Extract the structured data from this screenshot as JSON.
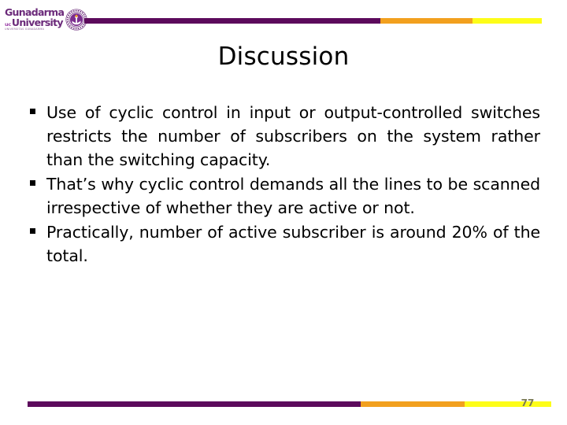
{
  "slide": {
    "title": "Discussion",
    "page_number": "77",
    "background_color": "#ffffff"
  },
  "logo": {
    "name": "Gunadarma University",
    "line1": "Gunadarma",
    "prefix": "uc",
    "line2": "University",
    "tagline": "UNIVERSITAS GUNADARMA",
    "emblem_icon": "university-crest-icon",
    "color": "#6b2a7a"
  },
  "decor": {
    "top_bar": [
      {
        "segment": "purple",
        "color": "#5c0a5c"
      },
      {
        "segment": "orange",
        "color": "#f2a01e"
      },
      {
        "segment": "yellow",
        "color": "#fdfd18"
      }
    ],
    "bottom_bar": [
      {
        "segment": "purple",
        "color": "#5c0a5c"
      },
      {
        "segment": "orange",
        "color": "#f2a01e"
      },
      {
        "segment": "yellow",
        "color": "#fdfd18"
      }
    ]
  },
  "content": {
    "bullet_glyph": "§",
    "bullets": [
      "Use of cyclic control in input or output-controlled switches restricts the number of subscribers on the system rather than the switching capacity.",
      "That’s why cyclic control demands all the lines to be scanned irrespective of whether they are active or not.",
      "Practically, number of active subscriber is around 20% of the total."
    ]
  }
}
